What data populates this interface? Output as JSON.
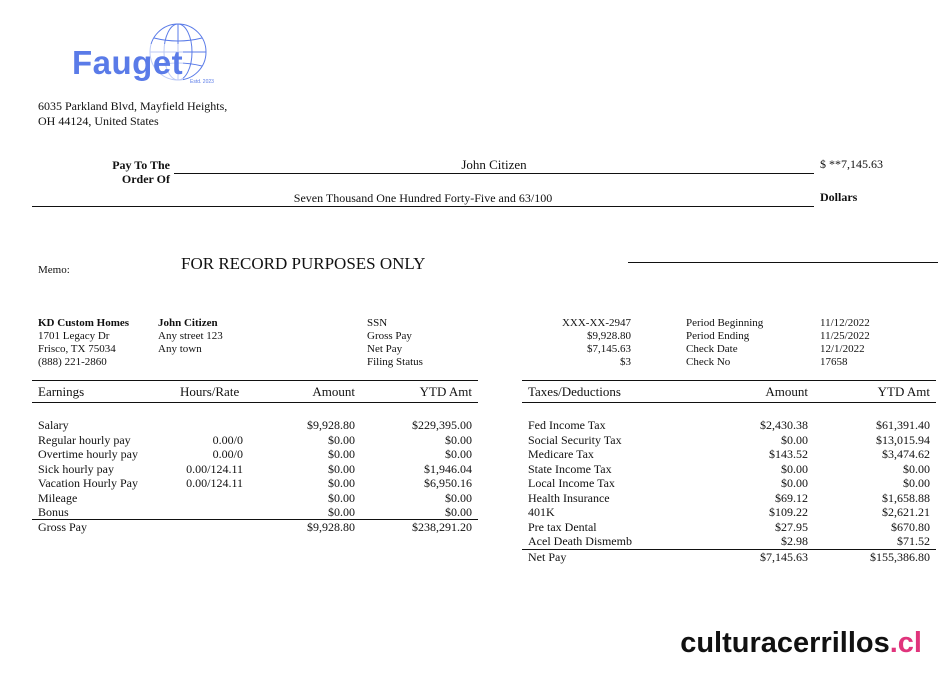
{
  "company": {
    "name": "Fauget",
    "est": "Estd. 2023",
    "address_line1": "6035 Parkland Blvd, Mayfield Heights,",
    "address_line2": "OH 44124, United States",
    "brand_color": "#5a7be8"
  },
  "check": {
    "pay_to_label1": "Pay To The",
    "pay_to_label2": "Order Of",
    "payee": "John Citizen",
    "amount": "$ **7,145.63",
    "amount_words": "Seven Thousand One Hundred Forty-Five and 63/100",
    "dollars_label": "Dollars",
    "memo_label": "Memo:",
    "memo_text": "FOR RECORD PURPOSES ONLY"
  },
  "info": {
    "employer": {
      "name": "KD Custom Homes",
      "line1": "1701 Legacy Dr",
      "line2": "Frisco, TX 75034",
      "phone": "(888) 221-2860"
    },
    "employee": {
      "name": "John Citizen",
      "line1": "Any street 123",
      "line2": "Any town"
    },
    "labels": [
      "SSN",
      "Gross Pay",
      "Net Pay",
      "Filing Status"
    ],
    "values": [
      "XXX-XX-2947",
      "$9,928.80",
      "$7,145.63",
      "$3"
    ],
    "period_labels": [
      "Period Beginning",
      "Period Ending",
      "Check Date",
      "Check No"
    ],
    "period_values": [
      "11/12/2022",
      "11/25/2022",
      "12/1/2022",
      "17658"
    ]
  },
  "earnings": {
    "headers": [
      "Earnings",
      "Hours/Rate",
      "Amount",
      "YTD Amt"
    ],
    "rows": [
      [
        "Salary",
        "",
        "$9,928.80",
        "$229,395.00"
      ],
      [
        "Regular hourly pay",
        "0.00/0",
        "$0.00",
        "$0.00"
      ],
      [
        "Overtime hourly pay",
        "0.00/0",
        "$0.00",
        "$0.00"
      ],
      [
        "Sick hourly pay",
        "0.00/124.11",
        "$0.00",
        "$1,946.04"
      ],
      [
        "Vacation Hourly Pay",
        "0.00/124.11",
        "$0.00",
        "$6,950.16"
      ],
      [
        "Mileage",
        "",
        "$0.00",
        "$0.00"
      ],
      [
        "Bonus",
        "",
        "$0.00",
        "$0.00"
      ]
    ],
    "total": [
      "Gross Pay",
      "",
      "$9,928.80",
      "$238,291.20"
    ]
  },
  "deductions": {
    "headers": [
      "Taxes/Deductions",
      "Amount",
      "YTD Amt"
    ],
    "rows": [
      [
        "Fed Income Tax",
        "$2,430.38",
        "$61,391.40"
      ],
      [
        "Social Security Tax",
        "$0.00",
        "$13,015.94"
      ],
      [
        "Medicare Tax",
        "$143.52",
        "$3,474.62"
      ],
      [
        "State Income Tax",
        "$0.00",
        "$0.00"
      ],
      [
        "Local Income Tax",
        "$0.00",
        "$0.00"
      ],
      [
        "Health Insurance",
        "$69.12",
        "$1,658.88"
      ],
      [
        "401K",
        "$109.22",
        "$2,621.21"
      ],
      [
        "Pre tax Dental",
        "$27.95",
        "$670.80"
      ],
      [
        "Acel Death Dismemb",
        "$2.98",
        "$71.52"
      ]
    ],
    "total": [
      "Net Pay",
      "$7,145.63",
      "$155,386.80"
    ]
  },
  "watermark": {
    "main": "culturacerrillos",
    "ext": ".cl",
    "ext_color": "#e0347c"
  }
}
